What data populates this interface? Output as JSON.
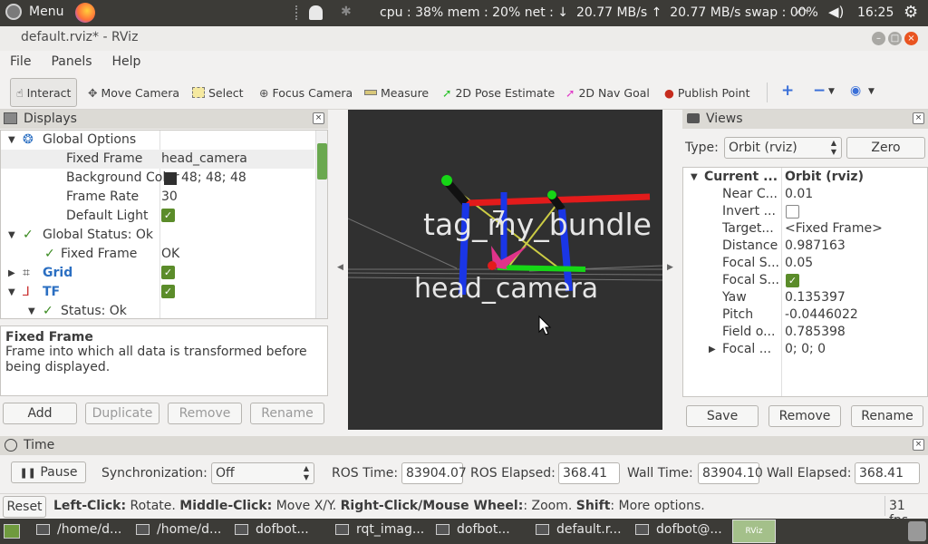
{
  "topbar": {
    "menu_label": "Menu",
    "status": "cpu : 38% mem : 20% net : ↓  20.77 MB/s ↑  20.77 MB/s swap : 00%",
    "clock": "16:25"
  },
  "window": {
    "title": "default.rviz* - RViz"
  },
  "menubar": [
    "File",
    "Panels",
    "Help"
  ],
  "toolbar": {
    "interact": "Interact",
    "move_camera": "Move Camera",
    "select": "Select",
    "focus_camera": "Focus Camera",
    "measure": "Measure",
    "pose_estimate": "2D Pose Estimate",
    "nav_goal": "2D Nav Goal",
    "publish_point": "Publish Point"
  },
  "displays": {
    "title": "Displays",
    "rows": [
      {
        "label": "Global Options",
        "value": ""
      },
      {
        "label": "Fixed Frame",
        "value": "head_camera"
      },
      {
        "label": "Background Color",
        "value": "48; 48; 48"
      },
      {
        "label": "Frame Rate",
        "value": "30"
      },
      {
        "label": "Default Light",
        "value": ""
      },
      {
        "label": "Global Status: Ok",
        "value": ""
      },
      {
        "label": "Fixed Frame",
        "value": "OK"
      },
      {
        "label": "Grid",
        "value": ""
      },
      {
        "label": "TF",
        "value": ""
      },
      {
        "label": "Status: Ok",
        "value": ""
      }
    ],
    "bg_swatch": "#303030",
    "desc_title": "Fixed Frame",
    "desc_text": "Frame into which all data is transformed before being displayed.",
    "buttons": {
      "add": "Add",
      "duplicate": "Duplicate",
      "remove": "Remove",
      "rename": "Rename"
    }
  },
  "viewport": {
    "label_bundle": "tag_my_bundle",
    "label_tag": "7",
    "label_camera": "head_camera",
    "bg": "#303030"
  },
  "views": {
    "title": "Views",
    "type_label": "Type:",
    "type_value": "Orbit (rviz)",
    "zero": "Zero",
    "rows": [
      {
        "label": "Current ...",
        "value": "Orbit (rviz)"
      },
      {
        "label": "Near C...",
        "value": "0.01"
      },
      {
        "label": "Invert ...",
        "value": ""
      },
      {
        "label": "Target...",
        "value": "<Fixed Frame>"
      },
      {
        "label": "Distance",
        "value": "0.987163"
      },
      {
        "label": "Focal S...",
        "value": "0.05"
      },
      {
        "label": "Focal S...",
        "value": ""
      },
      {
        "label": "Yaw",
        "value": "0.135397"
      },
      {
        "label": "Pitch",
        "value": "-0.0446022"
      },
      {
        "label": "Field o...",
        "value": "0.785398"
      },
      {
        "label": "Focal ...",
        "value": "0; 0; 0"
      }
    ],
    "buttons": {
      "save": "Save",
      "remove": "Remove",
      "rename": "Rename"
    }
  },
  "time": {
    "title": "Time",
    "pause": "Pause",
    "sync_label": "Synchronization:",
    "sync_value": "Off",
    "ros_time_label": "ROS Time:",
    "ros_time": "83904.07",
    "ros_elapsed_label": "ROS Elapsed:",
    "ros_elapsed": "368.41",
    "wall_time_label": "Wall Time:",
    "wall_time": "83904.10",
    "wall_elapsed_label": "Wall Elapsed:",
    "wall_elapsed": "368.41"
  },
  "statusbar": {
    "reset": "Reset",
    "h1": "Left-Click:",
    "t1": " Rotate. ",
    "h2": "Middle-Click:",
    "t2": " Move X/Y. ",
    "h3": "Right-Click/Mouse Wheel:",
    "t3": ": Zoom. ",
    "h4": "Shift",
    "t4": ": More options.",
    "fps": "31 fps"
  },
  "taskbar": [
    "/home/d...",
    "/home/d...",
    "dofbot...",
    "rqt_imag...",
    "dofbot...",
    "default.r...",
    "dofbot@..."
  ]
}
